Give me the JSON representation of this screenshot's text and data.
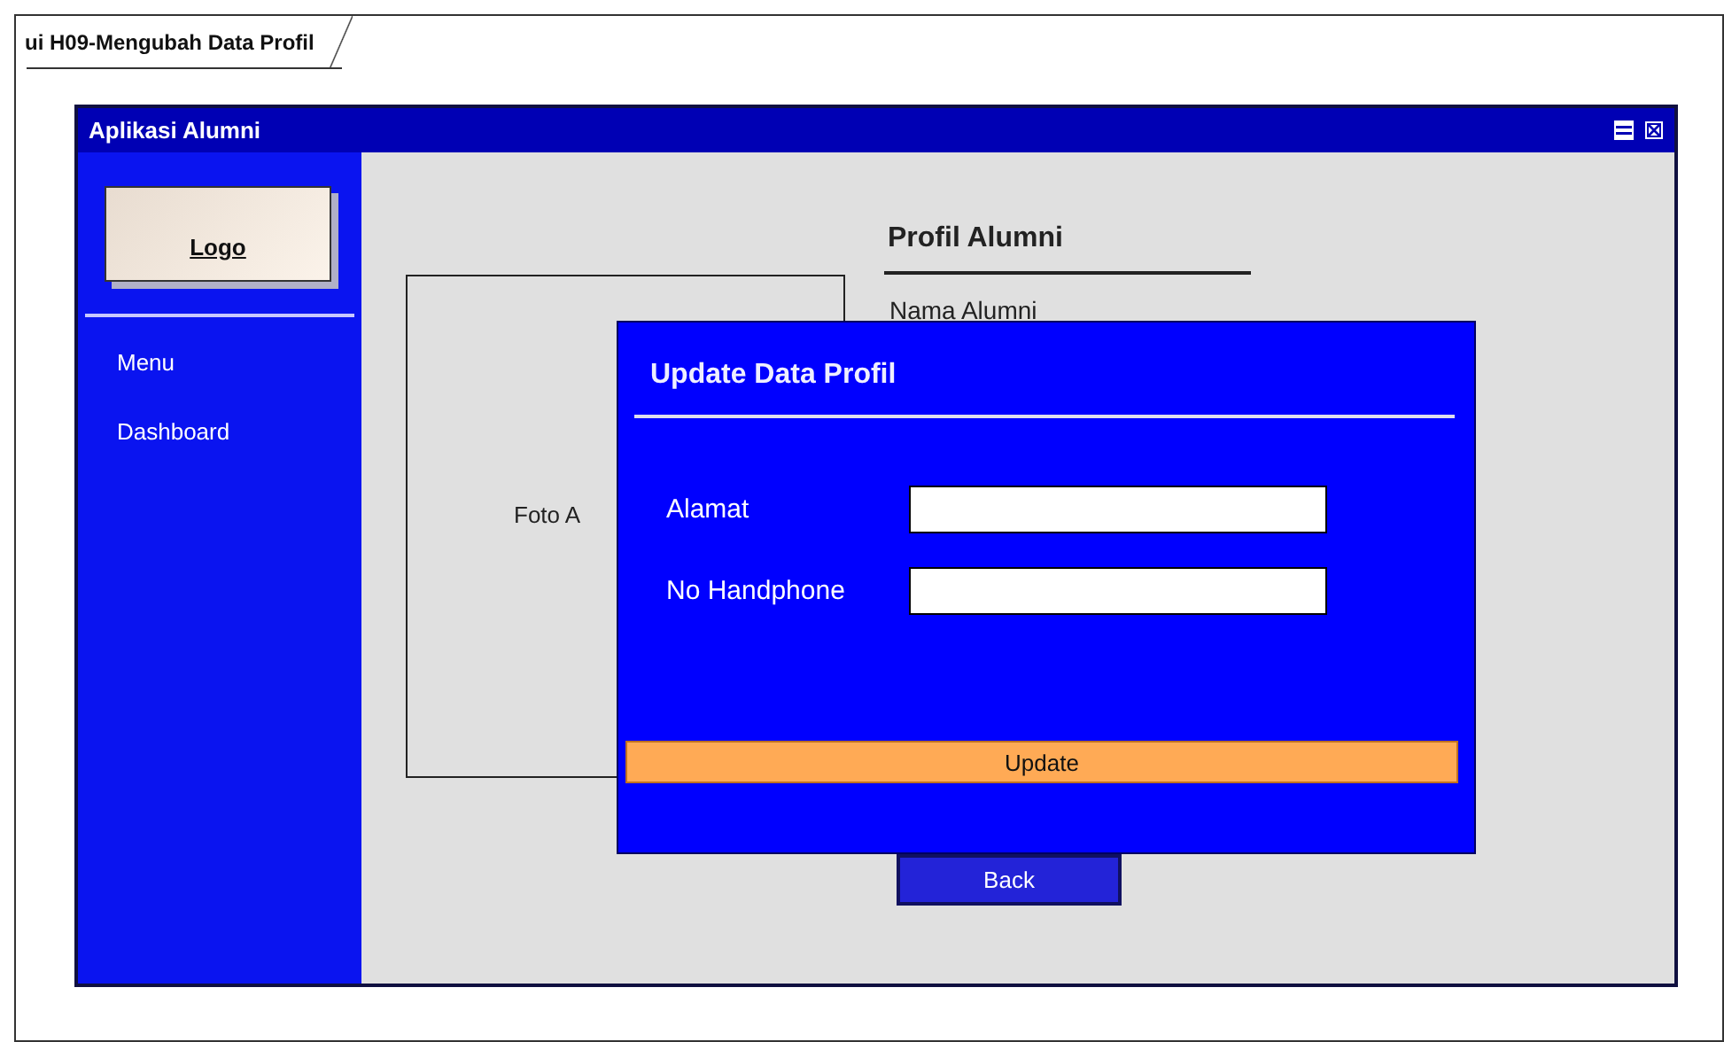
{
  "diagram": {
    "title": "ui H09-Mengubah Data Profil"
  },
  "window": {
    "title": "Aplikasi Alumni"
  },
  "sidebar": {
    "logo": "Logo",
    "items": [
      {
        "label": "Menu"
      },
      {
        "label": "Dashboard"
      }
    ]
  },
  "content": {
    "photo_label": "Foto A",
    "profile_heading": "Profil Alumni",
    "profile_fields": [
      "Nama Alumni"
    ]
  },
  "dialog": {
    "title": "Update Data Profil",
    "fields": [
      {
        "label": "Alamat"
      },
      {
        "label": "No Handphone"
      }
    ],
    "submit": "Update"
  },
  "back_button": "Back"
}
